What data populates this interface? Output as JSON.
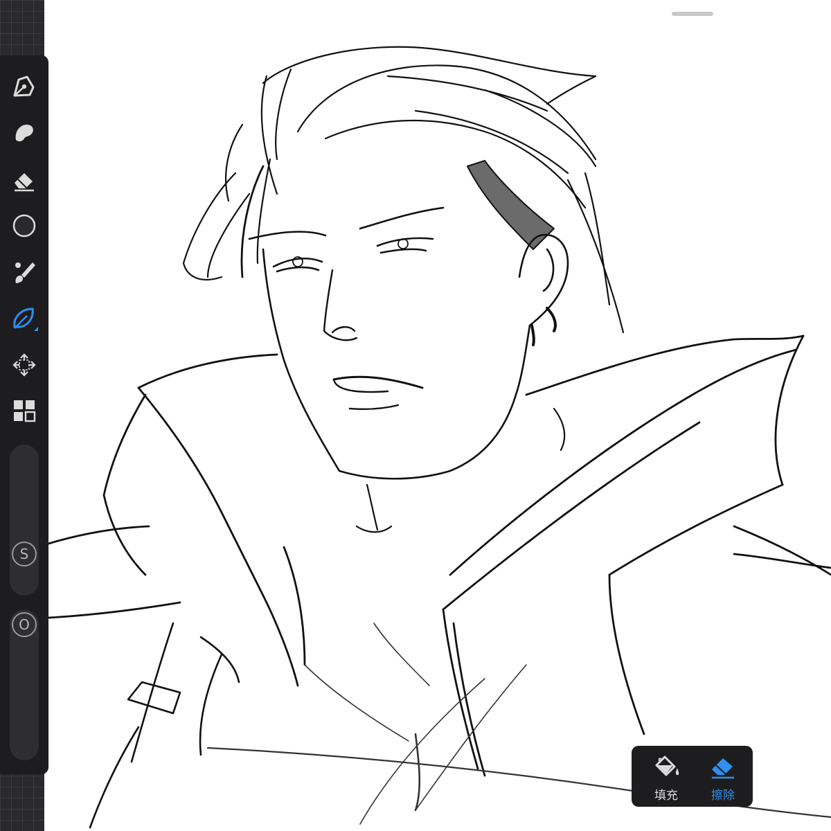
{
  "toolbar": {
    "tools": [
      {
        "id": "draw",
        "icon": "pen-nib-icon",
        "active": false
      },
      {
        "id": "smudge",
        "icon": "smudge-icon",
        "active": false
      },
      {
        "id": "eraser",
        "icon": "eraser-icon",
        "active": false
      },
      {
        "id": "color",
        "icon": "color-circle-icon",
        "active": false
      },
      {
        "id": "brushes",
        "icon": "brush-icon",
        "active": false
      },
      {
        "id": "selection",
        "icon": "lasso-leaf-icon",
        "active": true
      },
      {
        "id": "transform",
        "icon": "move-arrows-icon",
        "active": false
      },
      {
        "id": "layers",
        "icon": "layers-grid-icon",
        "active": false
      }
    ],
    "size_slider_label": "S",
    "opacity_slider_label": "O",
    "accent_color": "#2e8ff0",
    "icon_color": "#dcdcdc"
  },
  "fill_erase_popup": {
    "fill_label": "填充",
    "erase_label": "擦除",
    "active": "erase"
  }
}
